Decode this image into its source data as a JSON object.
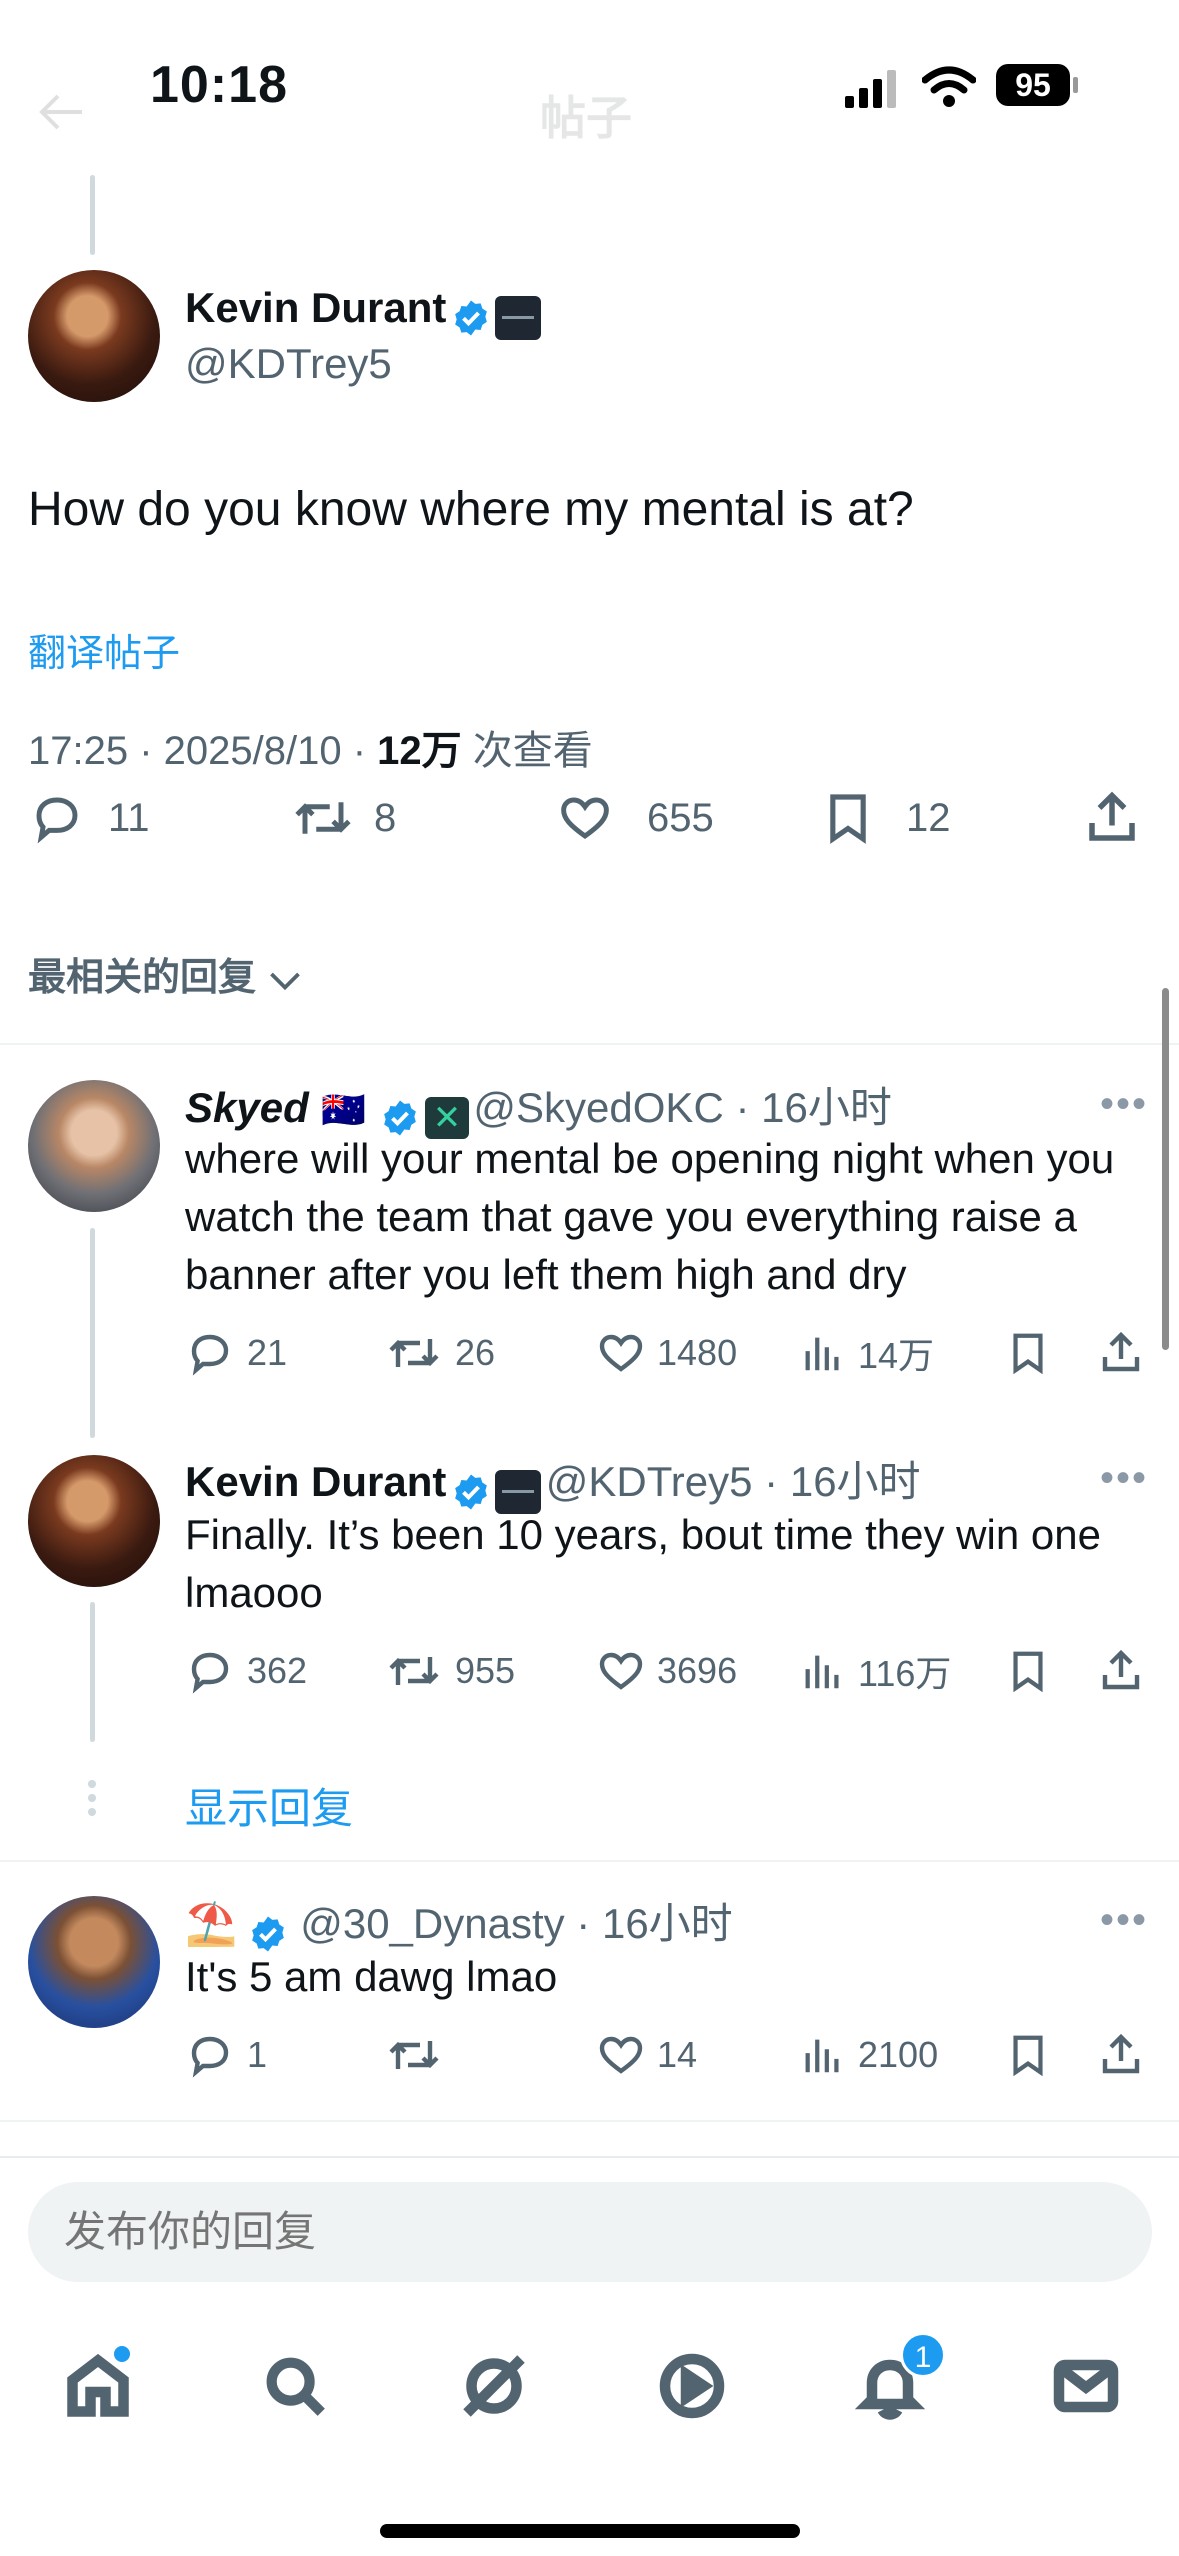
{
  "status_bar": {
    "time": "10:18",
    "battery": "95"
  },
  "header": {
    "title": "帖子"
  },
  "main_tweet": {
    "name": "Kevin Durant",
    "handle": "@KDTrey5",
    "text": "How do you know where my mental is at?",
    "translate": "翻译帖子",
    "meta_time": "17:25 · 2025/8/10 · ",
    "views_count": "12万",
    "views_label": " 次查看",
    "replies": "11",
    "retweets": "8",
    "likes": "655",
    "bookmarks": "12"
  },
  "sort": {
    "label": "最相关的回复"
  },
  "replies": [
    {
      "name": "Skyed",
      "flag": "🇦🇺",
      "handle": "@SkyedOKC",
      "time": "16小时",
      "text": "where will your mental be opening night when you watch the team that gave you everything raise a banner after you left them high and dry",
      "replies": "21",
      "retweets": "26",
      "likes": "1480",
      "views": "14万"
    },
    {
      "name": "Kevin Durant",
      "handle": "@KDTrey5",
      "time": "16小时",
      "text": "Finally. It’s been 10 years, bout time they win one lmaooo",
      "replies": "362",
      "retweets": "955",
      "likes": "3696",
      "views": "116万"
    },
    {
      "name": "⛱️",
      "handle": "@30_Dynasty",
      "time": "16小时",
      "text": "It's 5 am dawg lmao",
      "replies": "1",
      "retweets": "",
      "likes": "14",
      "views": "2100"
    }
  ],
  "show_replies": "显示回复",
  "composer": {
    "placeholder": "发布你的回复"
  },
  "tabs": {
    "notifications_badge": "1"
  },
  "colors": {
    "accent": "#1d9bf0",
    "text": "#0f1419",
    "muted": "#536471"
  }
}
